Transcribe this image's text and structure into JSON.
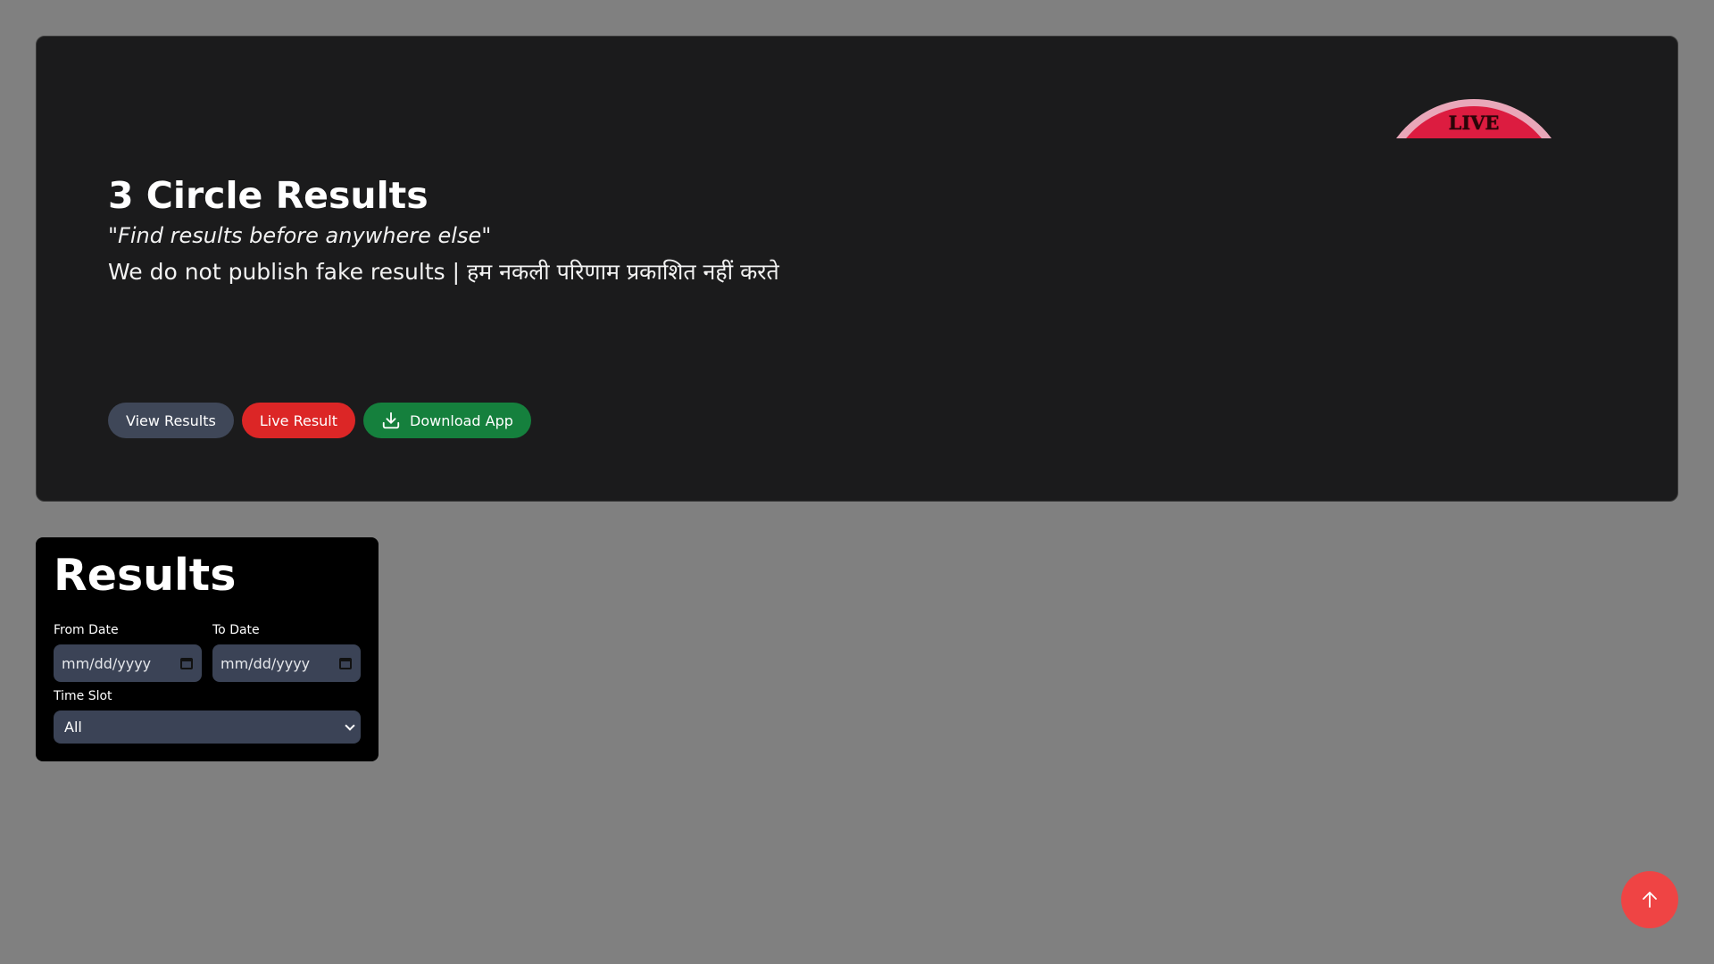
{
  "hero": {
    "title": "3 Circle Results",
    "quote_open": "\"",
    "quote_text": "Find results before anywhere else",
    "quote_close": "\"",
    "note": "We do not publish fake results | हम नकली परिणाम प्रकाशित नहीं करते",
    "badge_text": "LIVE",
    "buttons": {
      "view": "View Results",
      "live": "Live Result",
      "download": "Download App"
    }
  },
  "results": {
    "title": "Results",
    "from_label": "From Date",
    "from_value": "mm/dd/yyyy",
    "to_label": "To Date",
    "to_value": "mm/dd/yyyy",
    "slot_label": "Time Slot",
    "slot_value": "All"
  },
  "colors": {
    "page_bg": "#808080",
    "hero_bg": "#1b1b1c",
    "view_button": "#3f4758",
    "live_button": "#dc2626",
    "download_button": "#15803d",
    "scroll_top_button": "#ef4444"
  },
  "icons": {
    "download": "download-icon",
    "calendar": "calendar-icon",
    "chevron": "chevron-down-icon",
    "scroll_top": "arrow-up-icon"
  }
}
